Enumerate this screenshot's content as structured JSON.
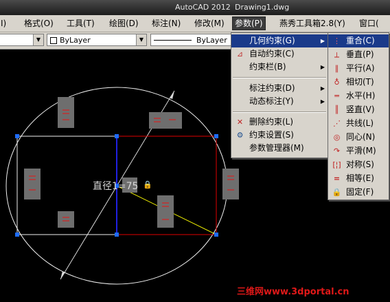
{
  "title": {
    "app": "AutoCAD 2012",
    "document": "Drawing1.dwg"
  },
  "menubar": [
    {
      "label": "I)"
    },
    {
      "label": "格式(O)"
    },
    {
      "label": "工具(T)"
    },
    {
      "label": "绘图(D)"
    },
    {
      "label": "标注(N)"
    },
    {
      "label": "修改(M)"
    },
    {
      "label": "参数(P)",
      "active": true
    },
    {
      "label": "燕秀工具箱2.8(Y)"
    },
    {
      "label": "窗口("
    }
  ],
  "toolbar": {
    "color_combo": "ByLayer",
    "linetype_combo": "ByLayer"
  },
  "canvas": {
    "dimension_label": "直径1=75",
    "lock_glyph": "🔒"
  },
  "params_menu": {
    "items": [
      {
        "label": "几何约束(G)",
        "icon": "geometric-constraint-icon",
        "submenu": true,
        "highlighted": true
      },
      {
        "label": "自动约束(C)",
        "icon": "auto-constrain-icon"
      },
      {
        "label": "约束栏(B)",
        "submenu": true
      },
      {
        "label": "标注约束(D)",
        "submenu": true
      },
      {
        "label": "动态标注(Y)",
        "submenu": true
      },
      {
        "label": "删除约束(L)",
        "icon": "delete-constraint-icon"
      },
      {
        "label": "约束设置(S)",
        "icon": "constraint-settings-icon"
      },
      {
        "label": "参数管理器(M)",
        "icon": "parameters-manager-icon"
      }
    ]
  },
  "geometric_submenu": {
    "items": [
      {
        "label": "重合(C)",
        "icon": "coincident-icon",
        "highlighted": true
      },
      {
        "label": "垂直(P)",
        "icon": "perpendicular-icon"
      },
      {
        "label": "平行(A)",
        "icon": "parallel-icon"
      },
      {
        "label": "相切(T)",
        "icon": "tangent-icon"
      },
      {
        "label": "水平(H)",
        "icon": "horizontal-icon"
      },
      {
        "label": "竖直(V)",
        "icon": "vertical-icon"
      },
      {
        "label": "共线(L)",
        "icon": "collinear-icon"
      },
      {
        "label": "同心(N)",
        "icon": "concentric-icon"
      },
      {
        "label": "平滑(M)",
        "icon": "smooth-icon"
      },
      {
        "label": "对称(S)",
        "icon": "symmetric-icon"
      },
      {
        "label": "相等(E)",
        "icon": "equal-icon"
      },
      {
        "label": "固定(F)",
        "icon": "fix-icon"
      }
    ]
  },
  "watermark": "三维网www.3dportal.cn",
  "colors": {
    "menu_bg": "#d8d4cc",
    "highlight": "#1a3a8a",
    "canvas_bg": "#000000",
    "red_line": "#e00000",
    "blue_line": "#2020e0",
    "yellow_line": "#e8e800",
    "grip": "#1e6cff"
  }
}
